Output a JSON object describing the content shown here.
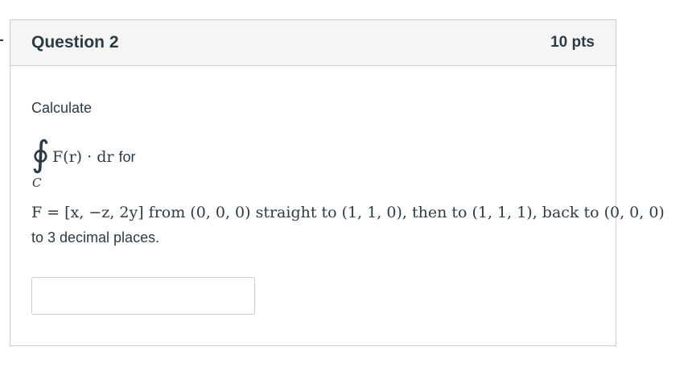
{
  "question": {
    "title": "Question 2",
    "points": "10 pts"
  },
  "body": {
    "lead": "Calculate",
    "integral_symbol": "∮",
    "integral_subscript": "C",
    "integrand": "F(r) · dr",
    "integrand_suffix": "for",
    "definition": "F = [x, −z, 2y] from (0, 0, 0) straight to (1, 1, 0), then to (1, 1, 1), back to (0, 0, 0)",
    "tail": "to 3 decimal places."
  },
  "answer": {
    "value": "",
    "placeholder": ""
  },
  "colors": {
    "text": "#2d3b45",
    "header_bg": "#f5f5f5",
    "border": "#c7cdd1"
  }
}
